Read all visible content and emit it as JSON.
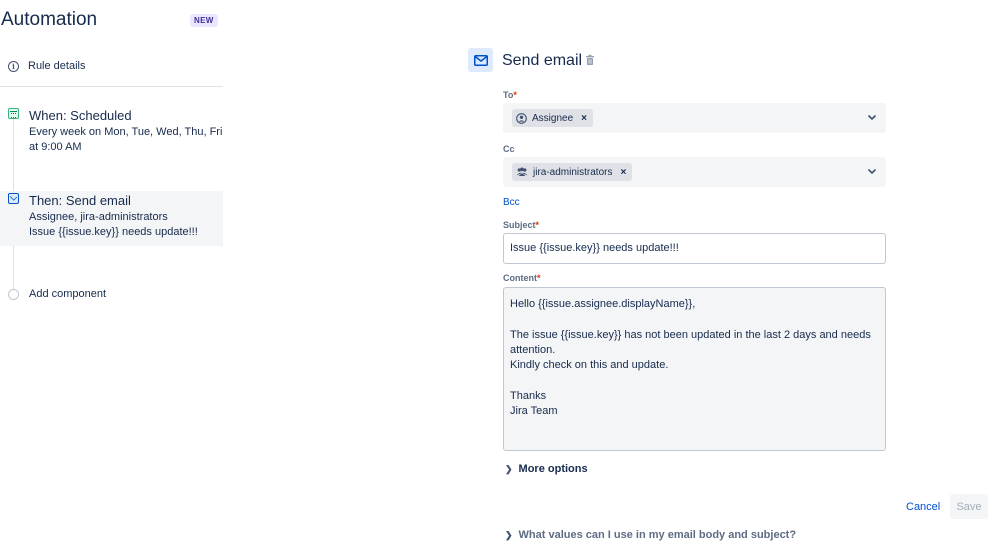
{
  "app": {
    "title": "Automation",
    "badge": "NEW"
  },
  "sidebar": {
    "rule_details": "Rule details",
    "trigger": {
      "title": "When: Scheduled",
      "line1": "Every week on Mon, Tue, Wed, Thu, Fri",
      "line2": "at 9:00 AM"
    },
    "action": {
      "title": "Then: Send email",
      "line1": "Assignee, jira-administrators",
      "line2": "Issue {{issue.key}} needs update!!!"
    },
    "add_component": "Add component"
  },
  "form": {
    "title": "Send email",
    "to": {
      "label": "To",
      "required": "*",
      "chips": [
        "Assignee"
      ]
    },
    "cc": {
      "label": "Cc",
      "chips": [
        "jira-administrators"
      ]
    },
    "bcc_link": "Bcc",
    "subject": {
      "label": "Subject",
      "required": "*",
      "value": "Issue {{issue.key}} needs update!!!"
    },
    "content": {
      "label": "Content",
      "required": "*",
      "value": "Hello {{issue.assignee.displayName}},\n\nThe issue {{issue.key}} has not been updated in the last 2 days and needs attention.\nKindly check on this and update.\n\nThanks\nJira Team"
    },
    "more_options": "More options",
    "cancel": "Cancel",
    "save": "Save",
    "help": "What values can I use in my email body and subject?"
  },
  "icons": {
    "rule_details": "info-icon",
    "trigger": "calendar-icon",
    "action": "mail-icon",
    "panel": "mail-icon",
    "delete": "trash-icon",
    "assignee_chip": "user-circle-icon",
    "group_chip": "people-icon",
    "dropdown": "chevron-down-icon",
    "expand": "chevron-right-icon"
  },
  "colors": {
    "brand": "#0052cc",
    "badge_bg": "#eae6ff",
    "badge_text": "#403294",
    "required": "#de350b",
    "trigger_icon": "#00875a"
  }
}
